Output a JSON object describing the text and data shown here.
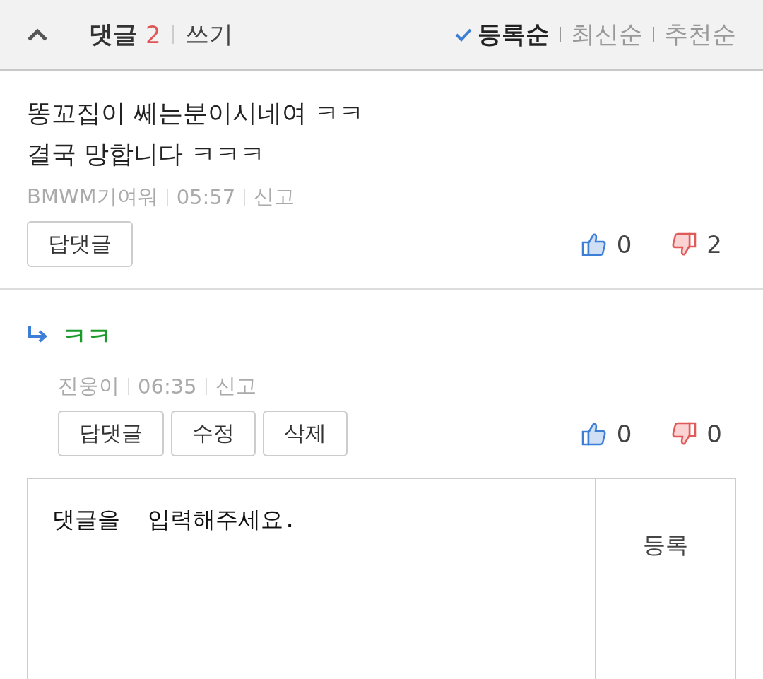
{
  "header": {
    "title": "댓글",
    "count": "2",
    "write": "쓰기",
    "sort": [
      {
        "label": "등록순",
        "selected": true
      },
      {
        "label": "최신순",
        "selected": false
      },
      {
        "label": "추천순",
        "selected": false
      }
    ]
  },
  "comments": [
    {
      "kind": "comment",
      "lines": [
        "똥꼬집이 쎄는분이시네여 ㅋㅋ",
        "결국 망합니다 ㅋㅋㅋ"
      ],
      "author": "BMWM기여워",
      "time": "05:57",
      "report": "신고",
      "actions": [
        "답댓글"
      ],
      "likes": "0",
      "dislikes": "2"
    },
    {
      "kind": "reply",
      "lines": [
        "ㅋㅋ"
      ],
      "author": "진웅이",
      "time": "06:35",
      "report": "신고",
      "actions": [
        "답댓글",
        "수정",
        "삭제"
      ],
      "likes": "0",
      "dislikes": "0"
    }
  ],
  "composer": {
    "placeholder": "댓글을  입력해주세요.",
    "submit": "등록"
  }
}
